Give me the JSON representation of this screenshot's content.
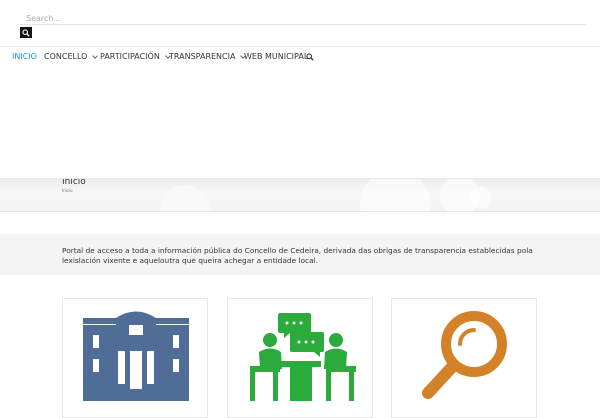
{
  "search": {
    "placeholder": "Search..."
  },
  "nav": {
    "items": [
      {
        "label": "INICIO",
        "active": true,
        "dropdown": false
      },
      {
        "label": "CONCELLO",
        "dropdown": true
      },
      {
        "label": "PARTICIPACIÓN",
        "dropdown": true
      },
      {
        "label": "TRANSPARENCIA",
        "dropdown": true
      },
      {
        "label": "WEB MUNICIPAL",
        "dropdown": false
      }
    ],
    "search_icon": "search-icon"
  },
  "page": {
    "title": "Inicio",
    "breadcrumb": "Inicio"
  },
  "intro": {
    "text": "Portal de acceso a toda a información pública do Concello de Cedeira, derivada das obrigas de transparencia establecidas pola lexislación vixente e aqueloutra que queira achegar a entidade local."
  },
  "cards": [
    {
      "icon": "town-hall-icon",
      "color": "#4f6d96"
    },
    {
      "icon": "meeting-participation-icon",
      "color": "#2bab3b"
    },
    {
      "icon": "magnifier-icon",
      "color": "#d4822a"
    }
  ],
  "colors": {
    "accent": "#1a8fd0"
  }
}
